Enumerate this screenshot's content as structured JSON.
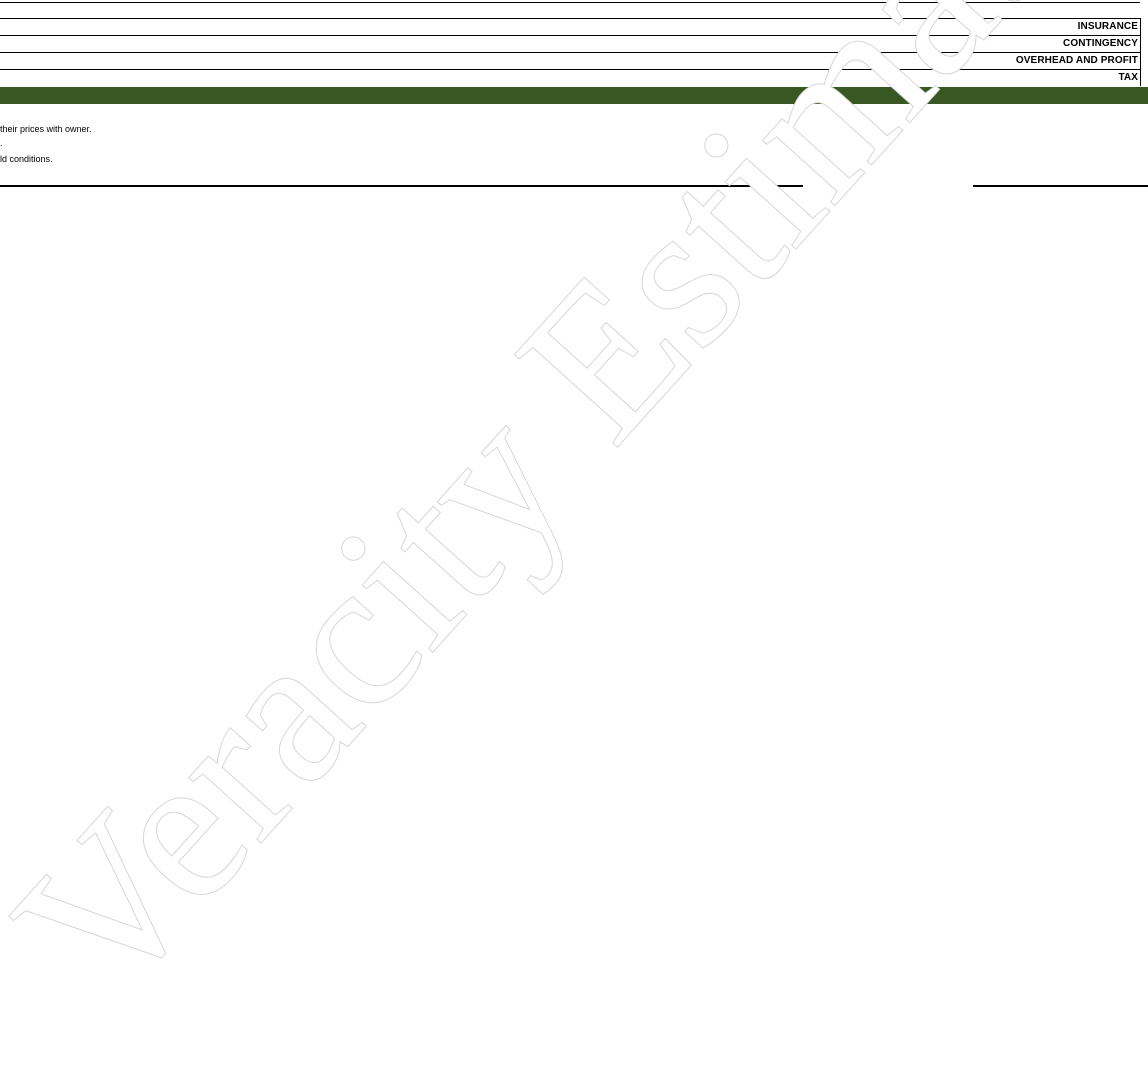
{
  "summary_rows": [
    {
      "label": "INSURANCE"
    },
    {
      "label": "CONTINGENCY"
    },
    {
      "label": "OVERHEAD AND PROFIT"
    },
    {
      "label": "TAX"
    }
  ],
  "notes": [
    "their prices with owner.",
    ".",
    "ld conditions."
  ],
  "watermark": {
    "text": "Veracity Estimating"
  },
  "colors": {
    "section_bar": "#385723",
    "watermark": "#d9d9d9"
  }
}
